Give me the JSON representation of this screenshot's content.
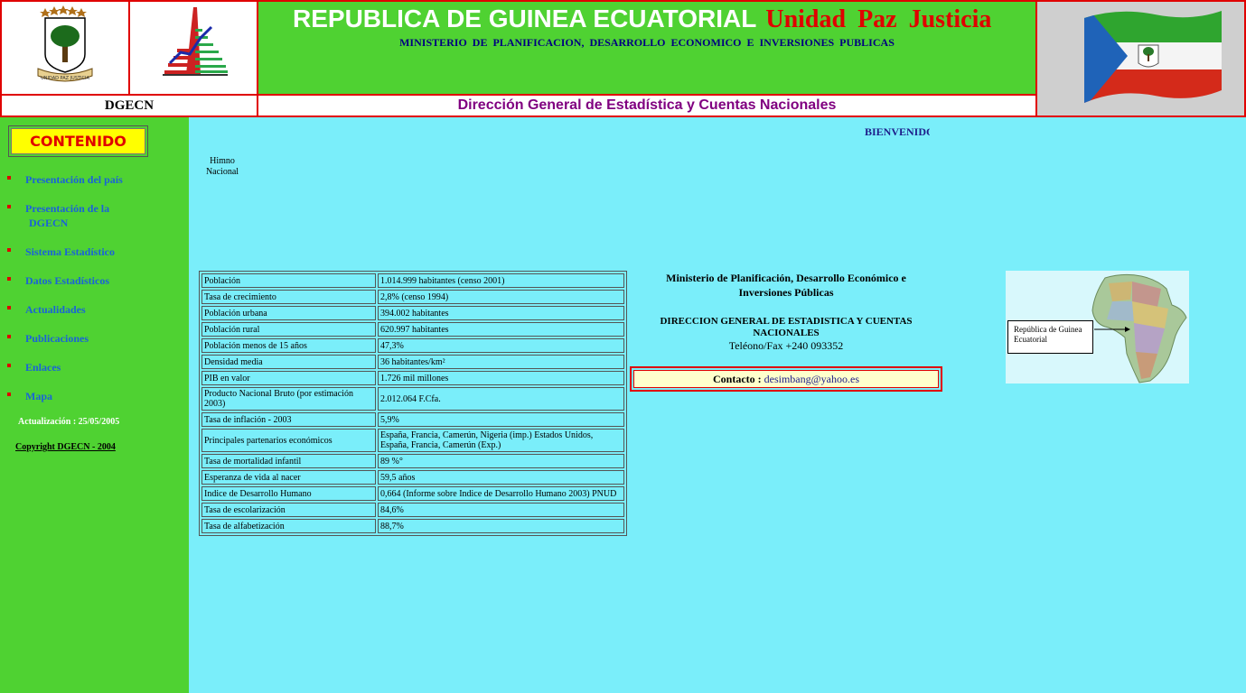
{
  "header": {
    "country": "REPUBLICA DE GUINEA ECUATORIAL",
    "motto": "Unidad  Paz  Justicia",
    "ministry": "MINISTERIO  DE  PLANIFICACION,  DESARROLLO  ECONOMICO  E  INVERSIONES   PUBLICAS",
    "short_name": "DGECN",
    "full_name": "Dirección General de Estadística y Cuentas Nacionales",
    "coat_of_arms_motto": "UNIDAD PAZ JUSTICIA"
  },
  "sidebar": {
    "contents_title": "CONTENIDO",
    "items": [
      {
        "label": "Presentación del país"
      },
      {
        "label": "Presentación de la",
        "label2": "DGECN"
      },
      {
        "label": "Sistema Estadístico"
      },
      {
        "label": "Datos Estadísticos"
      },
      {
        "label": "Actualidades"
      },
      {
        "label": "Publicaciones"
      },
      {
        "label": "Enlaces"
      },
      {
        "label": "Mapa"
      }
    ],
    "update": "Actualización :   25/05/2005",
    "copyright": "Copyright DGECN - 2004"
  },
  "main": {
    "welcome": "BIENVENIDOS",
    "anthem": "Himno Nacional",
    "stats": [
      {
        "k": "Población",
        "v": "1.014.999 habitantes (censo 2001)"
      },
      {
        "k": "Tasa de crecimiento",
        "v": "2,8% (censo 1994)"
      },
      {
        "k": "Población urbana",
        "v": "394.002 habitantes"
      },
      {
        "k": "Población rural",
        "v": "620.997 habitantes"
      },
      {
        "k": "Población menos de 15 años",
        "v": "47,3%"
      },
      {
        "k": "Densidad media",
        "v": "36 habitantes/km²"
      },
      {
        "k": "PIB en valor",
        "v": "1.726 mil millones"
      },
      {
        "k": "Producto Nacional Bruto       (por estimación 2003)",
        "v": "2.012.064 F.Cfa."
      },
      {
        "k": "Tasa de inflación - 2003",
        "v": "5,9%"
      },
      {
        "k": "Principales partenarios económicos",
        "v": "España, Francia, Camerún, Nigeria (imp.) Estados Unidos, España, Francia, Camerún (Exp.)"
      },
      {
        "k": "Tasa de mortalidad infantil",
        "v": "89 %°"
      },
      {
        "k": "Esperanza de vida al nacer",
        "v": "59,5 años"
      },
      {
        "k": "Indice de Desarrollo Humano",
        "v": "0,664 (Informe sobre Indice de Desarrollo Humano 2003) PNUD"
      },
      {
        "k": "Tasa de escolarización",
        "v": "84,6%"
      },
      {
        "k": "Tasa de alfabetización",
        "v": "88,7%"
      }
    ],
    "ministry_name": "Ministerio de Planificación, Desarrollo Económico e Inversiones Públicas",
    "dgecn_upper": "DIRECCION GENERAL DE ESTADISTICA Y CUENTAS NACIONALES",
    "phone": "Teléono/Fax +240 093352",
    "contact_label": "Contacto : ",
    "contact_email": "desimbang@yahoo.es",
    "map_label": "República de Guinea Ecuatorial"
  },
  "colors": {
    "header_green": "#4fd232",
    "page_cyan": "#7aeefa",
    "border_red": "#e00000",
    "nav_blue": "#1a63d8",
    "title_purple": "#800080"
  }
}
